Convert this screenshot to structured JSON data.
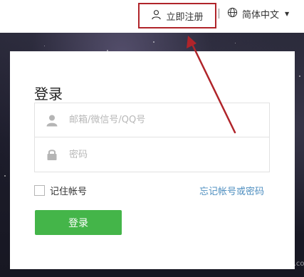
{
  "header": {
    "register_label": "立即注册",
    "language_label": "简体中文",
    "icons": {
      "register": "user-icon",
      "language": "globe-icon",
      "caret": "caret-down-icon"
    }
  },
  "login": {
    "title": "登录",
    "account_placeholder": "邮箱/微信号/QQ号",
    "account_value": "",
    "password_placeholder": "密码",
    "password_value": "",
    "remember_label": "记住帐号",
    "remember_checked": false,
    "forgot_label": "忘记帐号或密码",
    "submit_label": "登录",
    "icons": {
      "account": "user-icon",
      "password": "lock-icon"
    }
  },
  "colors": {
    "accent_green": "#44b549",
    "link_blue": "#4f8fc0",
    "annotation_red": "#b0242a"
  },
  "watermark": {
    "main": "Bai 经验",
    "sub": "jingyan.baidu.com"
  }
}
